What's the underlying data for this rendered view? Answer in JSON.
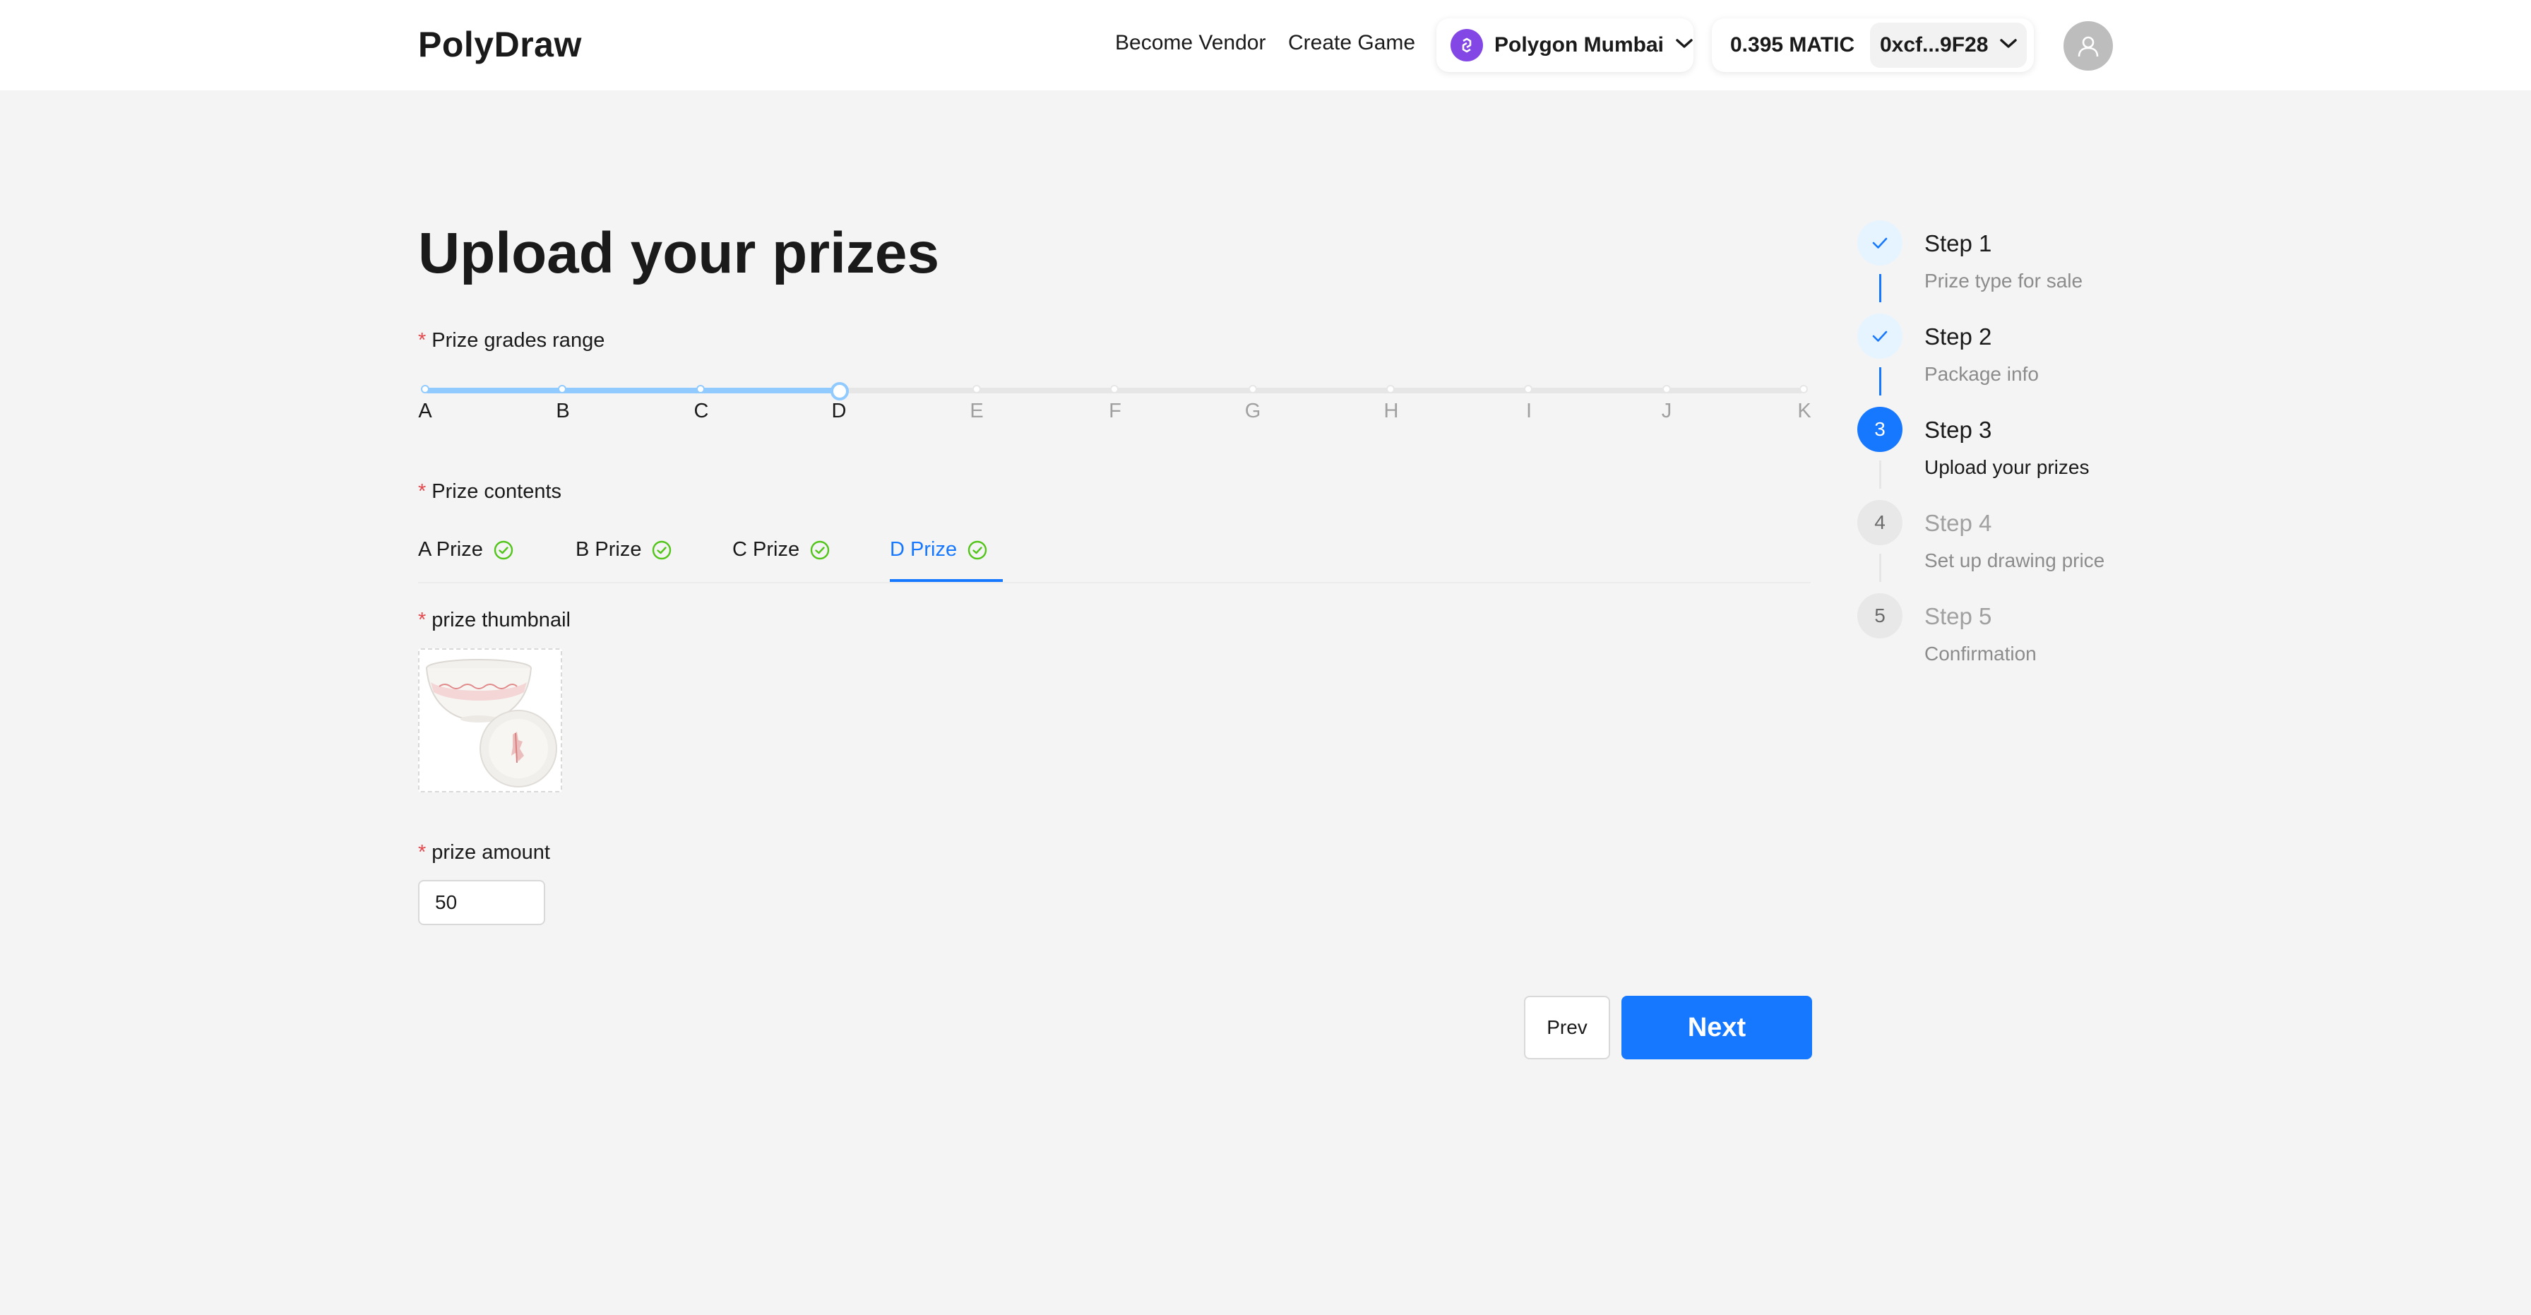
{
  "header": {
    "logo": "PolyDraw",
    "nav": [
      "Become Vendor",
      "Create Game"
    ],
    "network": "Polygon Mumbai",
    "balance": "0.395 MATIC",
    "address": "0xcf...9F28"
  },
  "page": {
    "title": "Upload your prizes"
  },
  "grades": {
    "label": "Prize grades range",
    "marks": [
      "A",
      "B",
      "C",
      "D",
      "E",
      "F",
      "G",
      "H",
      "I",
      "J",
      "K"
    ],
    "range_start": "A",
    "range_end": "D"
  },
  "contents": {
    "label": "Prize contents",
    "tabs": [
      {
        "label": "A Prize",
        "complete": true
      },
      {
        "label": "B Prize",
        "complete": true
      },
      {
        "label": "C Prize",
        "complete": true
      },
      {
        "label": "D Prize",
        "complete": true,
        "active": true
      }
    ]
  },
  "thumbnail": {
    "label": "prize thumbnail"
  },
  "amount": {
    "label": "prize amount",
    "value": "50"
  },
  "buttons": {
    "prev": "Prev",
    "next": "Next"
  },
  "steps": [
    {
      "number": "1",
      "title": "Step 1",
      "desc": "Prize type for sale",
      "status": "finish"
    },
    {
      "number": "2",
      "title": "Step 2",
      "desc": "Package info",
      "status": "finish"
    },
    {
      "number": "3",
      "title": "Step 3",
      "desc": "Upload your prizes",
      "status": "process"
    },
    {
      "number": "4",
      "title": "Step 4",
      "desc": "Set up drawing price",
      "status": "wait"
    },
    {
      "number": "5",
      "title": "Step 5",
      "desc": "Confirmation",
      "status": "wait"
    }
  ],
  "colors": {
    "primary": "#1677ff",
    "slider_track": "#91caff",
    "success": "#52c41a",
    "required": "#e5484d",
    "polygon": "#8247e5"
  }
}
